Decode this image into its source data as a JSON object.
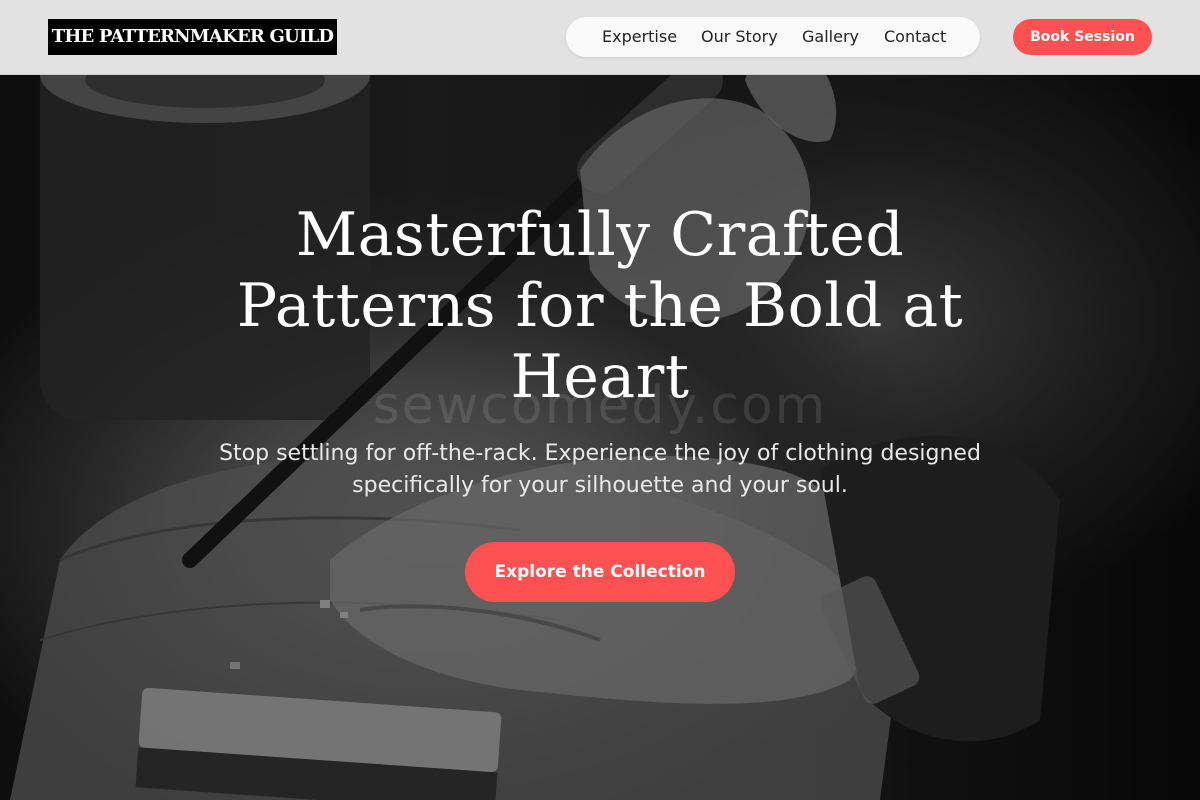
{
  "header": {
    "logo_text": "THE PATTERNMAKER GUILD",
    "nav": [
      {
        "label": "Expertise"
      },
      {
        "label": "Our Story"
      },
      {
        "label": "Gallery"
      },
      {
        "label": "Contact"
      }
    ],
    "book_label": "Book Session"
  },
  "hero": {
    "title": "Masterfully Crafted Patterns for the Bold at Heart",
    "subtitle": "Stop settling for off-the-rack. Experience the joy of clothing designed specifically for your silhouette and your soul.",
    "cta_label": "Explore the Collection",
    "watermark": "sewcomedy.com"
  },
  "colors": {
    "accent": "#fd5152",
    "header_bg": "#e2e2e2",
    "logo_bg": "#000000"
  }
}
